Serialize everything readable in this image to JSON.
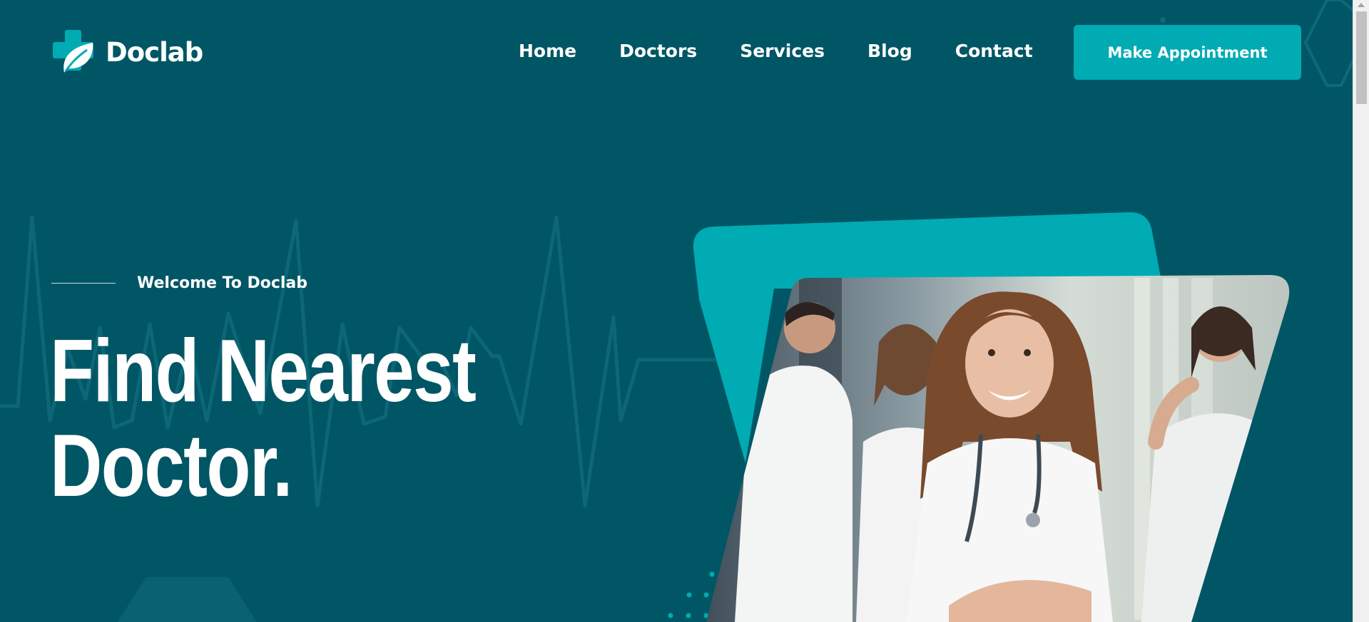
{
  "brand": {
    "name": "Doclab",
    "accent_color": "#00abb3",
    "background_color": "#015665"
  },
  "nav": {
    "items": [
      {
        "label": "Home"
      },
      {
        "label": "Doctors"
      },
      {
        "label": "Services"
      },
      {
        "label": "Blog"
      },
      {
        "label": "Contact"
      }
    ],
    "cta_label": "Make Appointment"
  },
  "hero": {
    "eyebrow": "Welcome To Doclab",
    "title_line1": "Find Nearest",
    "title_line2": "Doctor."
  },
  "icons": {
    "logo": "medical-cross-leaf-icon",
    "background": "heartbeat-line-icon"
  }
}
